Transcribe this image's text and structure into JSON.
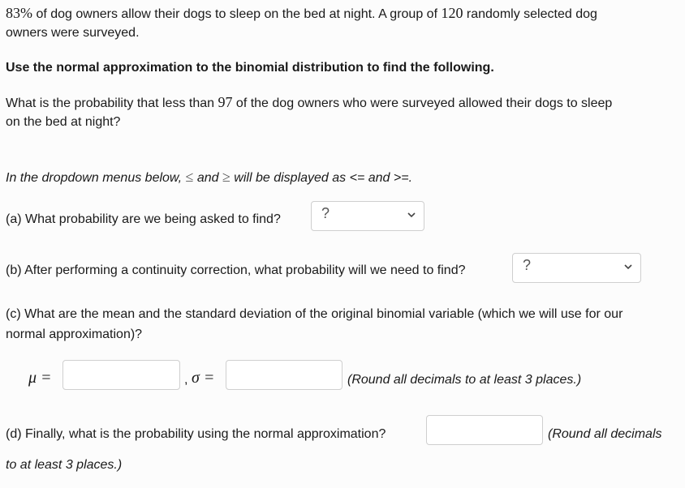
{
  "problem": {
    "percent": "83%",
    "intro_part1": " of dog owners allow their dogs to sleep on the bed at night. A group of ",
    "n": "120",
    "intro_part2": " randomly selected dog",
    "intro_line2": "owners were surveyed.",
    "instruction": "Use the normal approximation to the binomial distribution to find the following.",
    "question_part1": "What is the probability that less than ",
    "k": "97",
    "question_part2": " of the dog owners who were surveyed allowed their dogs to sleep",
    "question_line2": "on the bed at night?"
  },
  "note": {
    "part1": "In the dropdown menus below, ",
    "le": "≤",
    "and": " and ",
    "ge": "≥",
    "part2": " will be displayed as <= and >=."
  },
  "part_a": {
    "label": "(a) What probability are we being asked to find?",
    "selected": "?"
  },
  "part_b": {
    "label": "(b) After performing a continuity correction, what probability will we need to find?",
    "selected": "?"
  },
  "part_c": {
    "label_line1": "(c) What are the mean and the standard deviation of the original binomial variable (which we will use for our",
    "label_line2": "normal approximation)?",
    "mu_label": "μ =",
    "sigma_label": "σ =",
    "comma": ",",
    "mu_value": "",
    "sigma_value": "",
    "round_note": "(Round all decimals to at least 3 places.)"
  },
  "part_d": {
    "label": "(d) Finally, what is the probability using the normal approximation?",
    "value": "",
    "round_note_line1": "(Round all decimals",
    "round_note_line2": "to at least 3 places.)"
  }
}
